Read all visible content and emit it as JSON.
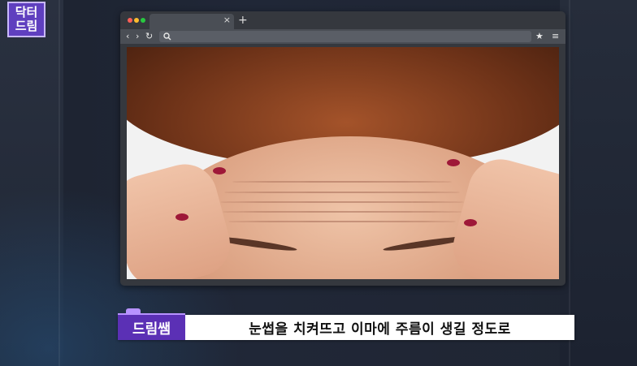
{
  "logo": {
    "line1": "닥터",
    "line2": "드림"
  },
  "browser": {
    "tab_close": "×",
    "new_tab": "+",
    "nav": {
      "back": "‹",
      "forward": "›",
      "reload": "↻",
      "bookmark": "★",
      "menu": "≡"
    }
  },
  "caption": {
    "speaker": "드림쌤",
    "text": "눈썹을 치켜뜨고 이마에 주름이 생길 정도로"
  },
  "colors": {
    "accent": "#5b30b5",
    "accent_light": "#b792ff",
    "logo_bg": "#5f3fbf"
  }
}
